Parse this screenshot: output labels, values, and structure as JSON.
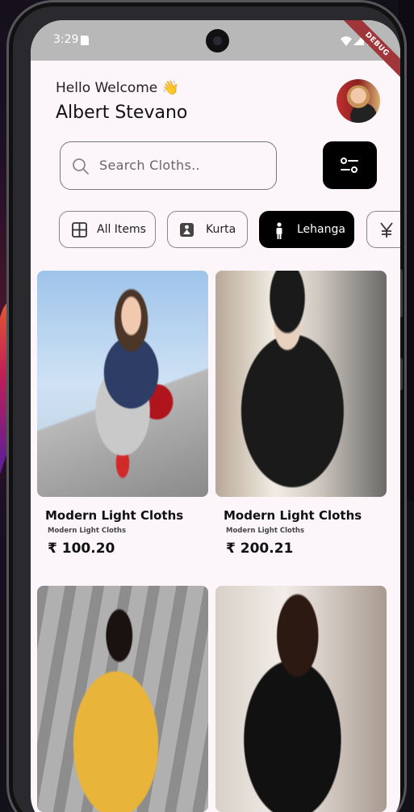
{
  "status_bar": {
    "time": "3:29",
    "debug_label": "DEBUG"
  },
  "header": {
    "greeting": "Hello Welcome 👋",
    "user_name": "Albert Stevano"
  },
  "search": {
    "placeholder": "Search Cloths.."
  },
  "categories": [
    {
      "label": "All Items",
      "icon": "grid-icon",
      "active": false
    },
    {
      "label": "Kurta",
      "icon": "dress-icon",
      "active": false
    },
    {
      "label": "Lehanga",
      "icon": "person-icon",
      "active": true
    },
    {
      "label": "",
      "icon": "yen-icon",
      "active": false
    }
  ],
  "products": [
    {
      "title": "Modern Light Cloths",
      "subtitle": "Modern Light Cloths",
      "price": "₹ 100.20"
    },
    {
      "title": "Modern Light Cloths",
      "subtitle": "Modern Light Cloths",
      "price": "₹ 200.21"
    },
    {
      "title": "",
      "subtitle": "",
      "price": ""
    },
    {
      "title": "",
      "subtitle": "",
      "price": ""
    }
  ],
  "colors": {
    "accent": "#000000",
    "background": "#fcf6fb",
    "status_bar": "#b8b8b8",
    "debug_banner": "#a0353a"
  }
}
